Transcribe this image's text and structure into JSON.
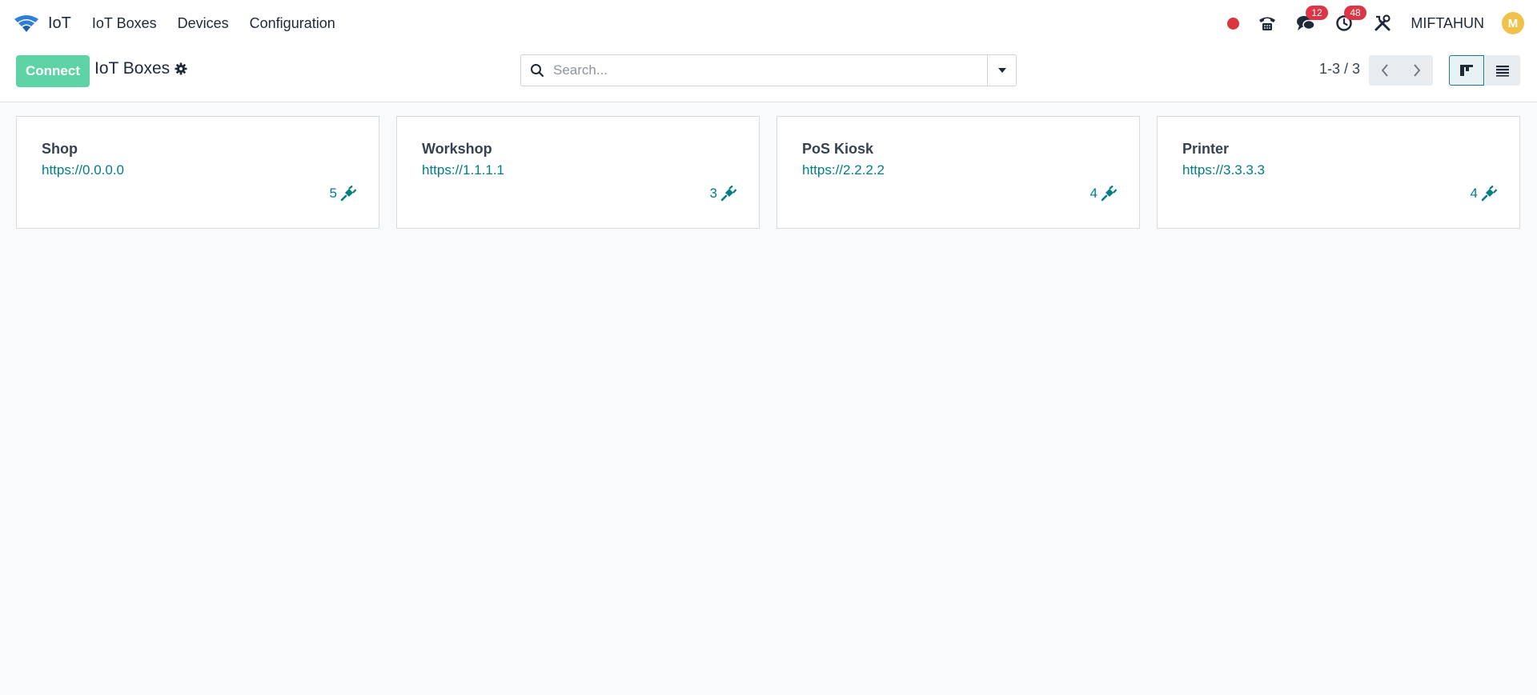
{
  "app": {
    "name": "IoT",
    "menu": [
      "IoT Boxes",
      "Devices",
      "Configuration"
    ]
  },
  "systray": {
    "messages_count": "12",
    "activities_count": "48",
    "user_name": "MIFTAHUN",
    "avatar_initial": "M"
  },
  "control_panel": {
    "connect_label": "Connect",
    "breadcrumb": "IoT Boxes",
    "search_placeholder": "Search...",
    "pager": "1-3 / 3"
  },
  "cards": [
    {
      "name": "Shop",
      "url": "https://0.0.0.0",
      "device_count": "5"
    },
    {
      "name": "Workshop",
      "url": "https://1.1.1.1",
      "device_count": "3"
    },
    {
      "name": "PoS Kiosk",
      "url": "https://2.2.2.2",
      "device_count": "4"
    },
    {
      "name": "Printer",
      "url": "https://3.3.3.3",
      "device_count": "4"
    }
  ],
  "colors": {
    "accent": "#017e84",
    "connect_button": "#5ed3a6",
    "badge": "#dc3545",
    "record_dot": "#d9363e"
  },
  "icons": {
    "brand": "wifi-logo-icon",
    "phone": "phone-icon",
    "messages": "chat-icon",
    "activities": "clock-icon",
    "debug": "tools-icon",
    "settings": "gear-icon",
    "search": "search-icon",
    "dropdown": "caret-down-icon",
    "devices": "plug-icon"
  }
}
